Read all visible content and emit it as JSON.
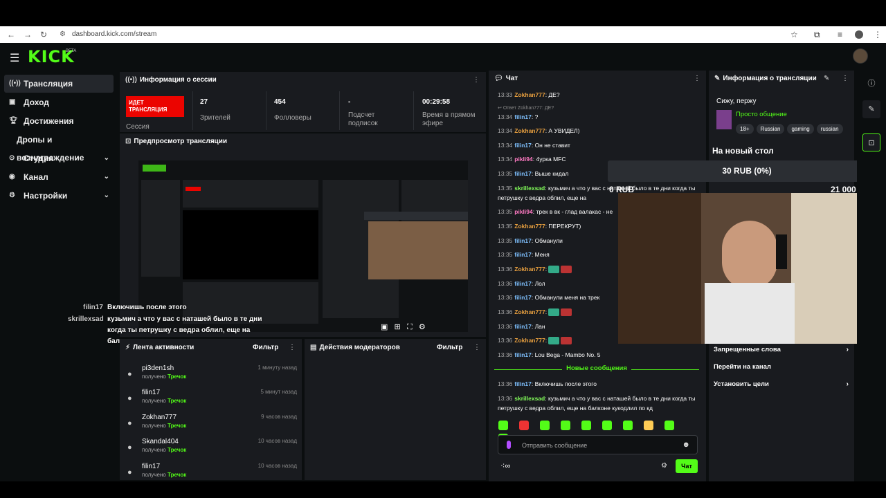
{
  "browser": {
    "url": "dashboard.kick.com/stream"
  },
  "header": {
    "logo": "KICK",
    "beta": "BETA"
  },
  "sidebar": {
    "items": [
      {
        "label": "Трансляция",
        "icon": "broadcast-icon"
      },
      {
        "label": "Доход",
        "icon": "wallet-icon"
      },
      {
        "label": "Достижения",
        "icon": "trophy-icon"
      },
      {
        "label": "Дропы и вознаграждение",
        "icon": ""
      },
      {
        "label": "Студия",
        "icon": "studio-icon"
      },
      {
        "label": "Канал",
        "icon": "channel-icon"
      },
      {
        "label": "Настройки",
        "icon": "gear-icon"
      }
    ]
  },
  "session": {
    "title": "Информация о сессии",
    "live_label": "ИДЕТ ТРАНСЛЯЦИЯ",
    "session_label": "Сессия",
    "stats": [
      {
        "value": "27",
        "label": "Зрителей"
      },
      {
        "value": "454",
        "label": "Фолловеры"
      },
      {
        "value": "-",
        "label": "Подсчет подписок"
      },
      {
        "value": "00:29:58",
        "label": "Время в прямом эфире"
      }
    ]
  },
  "preview": {
    "title": "Предпросмотр трансляции"
  },
  "activity": {
    "title": "Лента активности",
    "filter": "Фильтр",
    "items": [
      {
        "name": "pi3den1sh",
        "sub": "получено",
        "item": "Тречок",
        "time": "1 минуту назад"
      },
      {
        "name": "filin17",
        "sub": "получено",
        "item": "Тречок",
        "time": "5 минут назад"
      },
      {
        "name": "Zokhan777",
        "sub": "получено",
        "item": "Тречок",
        "time": "9 часов назад"
      },
      {
        "name": "Skandal404",
        "sub": "получено",
        "item": "Тречок",
        "time": "10 часов назад"
      },
      {
        "name": "filin17",
        "sub": "получено",
        "item": "Тречок",
        "time": "10 часов назад"
      }
    ]
  },
  "mods": {
    "title": "Действия модераторов",
    "filter": "Фильтр"
  },
  "chat": {
    "title": "Чат",
    "reply_text": "Ответ Zokhan777: ДЕ?",
    "messages": [
      {
        "t": "13:33",
        "u": "Zokhan777",
        "c": "u1",
        "m": ": ДЕ?"
      },
      {
        "t": "13:34",
        "u": "filin17",
        "c": "u2",
        "m": ": ?"
      },
      {
        "t": "13:34",
        "u": "Zokhan777",
        "c": "u1",
        "m": ": А УВИДЕЛ)"
      },
      {
        "t": "13:34",
        "u": "filin17",
        "c": "u2",
        "m": ": Он не ставит"
      },
      {
        "t": "13:34",
        "u": "pikli94",
        "c": "u4",
        "m": ": 4урка MFC"
      },
      {
        "t": "13:35",
        "u": "filin17",
        "c": "u2",
        "m": ": Выше кидал"
      },
      {
        "t": "13:35",
        "u": "skrillexsad",
        "c": "u3",
        "m": ": кузьмич а что у вас с наташей было в те дни когда ты петрушку с ведра облил, еще на"
      },
      {
        "t": "13:35",
        "u": "pikli94",
        "c": "u4",
        "m": ": трек в вк - глад валакас - не"
      },
      {
        "t": "13:35",
        "u": "Zokhan777",
        "c": "u1",
        "m": ": ПЕРЕКРУТ)"
      },
      {
        "t": "13:35",
        "u": "filin17",
        "c": "u2",
        "m": ": Обманули"
      },
      {
        "t": "13:35",
        "u": "filin17",
        "c": "u2",
        "m": ": Меня"
      },
      {
        "t": "13:36",
        "u": "Zokhan777",
        "c": "u1",
        "m": ":"
      },
      {
        "t": "13:36",
        "u": "filin17",
        "c": "u2",
        "m": ": Лол"
      },
      {
        "t": "13:36",
        "u": "filin17",
        "c": "u2",
        "m": ": Обманули меня на трек"
      },
      {
        "t": "13:36",
        "u": "Zokhan777",
        "c": "u1",
        "m": ":"
      },
      {
        "t": "13:36",
        "u": "filin17",
        "c": "u2",
        "m": ": Лан"
      },
      {
        "t": "13:36",
        "u": "Zokhan777",
        "c": "u1",
        "m": ":"
      },
      {
        "t": "13:36",
        "u": "filin17",
        "c": "u2",
        "m": ": Lou Bega - Mambo No. 5"
      }
    ],
    "new_messages_label": "Новые сообщения",
    "new_messages": [
      {
        "t": "13:36",
        "u": "filin17",
        "c": "u2",
        "m": ": Включишь после этого"
      },
      {
        "t": "13:36",
        "u": "skrillexsad",
        "c": "u3",
        "m": ": кузьмич а что у вас с наташей было в те дни когда ты петрушку с ведра облил, еще на балконе кукодлил по кд"
      }
    ],
    "input_placeholder": "Отправить сообщение",
    "send_label": "Чат"
  },
  "stream_info": {
    "title": "Информация о трансляции",
    "stream_title": "Сижу, пержу",
    "category": "Просто общение",
    "tags": [
      "18+",
      "Russian",
      "gaming",
      "russian"
    ],
    "goal_title": "На новый стол",
    "goal_progress": "30 RUB (0%)",
    "goal_start": "0 RUB",
    "goal_end": "21 000 RUB",
    "links": [
      {
        "label": "Запрещенные слова"
      },
      {
        "label": "Перейти на канал"
      },
      {
        "label": "Установить цели"
      }
    ]
  },
  "overlay_chat": [
    {
      "user": "filin17",
      "text": "Включишь после этого"
    },
    {
      "user": "skrillexsad",
      "text": "кузьмич а что у вас с наташей было в те дни когда ты петрушку с ведра облил, еще на балконе кукодлил по кд"
    }
  ],
  "colors": {
    "accent": "#53fc18",
    "live": "#eb0400",
    "panel": "#191b1f",
    "bg": "#0b0e0f"
  }
}
